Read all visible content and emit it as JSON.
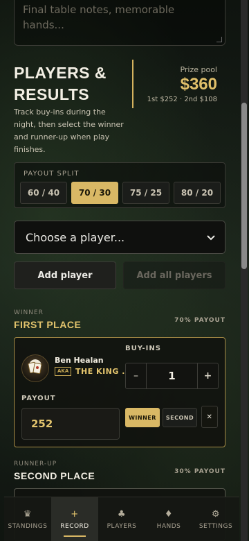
{
  "notes": {
    "placeholder": "Final table notes, memorable hands..."
  },
  "section": {
    "title": "PLAYERS & RESULTS",
    "description": "Track buy-ins during the night, then select the winner and runner-up when play finishes."
  },
  "prize_pool": {
    "label": "Prize pool",
    "amount": "$360",
    "split": "1st $252 · 2nd $108"
  },
  "payout_split": {
    "label": "PAYOUT SPLIT",
    "options": [
      "60 / 40",
      "70 / 30",
      "75 / 25",
      "80 / 20"
    ],
    "selected": "70 / 30"
  },
  "player_select": {
    "value": "Choose a player..."
  },
  "actions": {
    "add_player": "Add player",
    "add_all_players": "Add all players"
  },
  "first_place": {
    "kicker": "WINNER",
    "title": "FIRST PLACE",
    "payout_pct": "70% PAYOUT",
    "player": {
      "name": "Ben Healan",
      "aka_label": "AKA",
      "aka": "THE KING ..."
    },
    "buyins_label": "BUY-INS",
    "buyins": "1",
    "minus": "–",
    "plus": "+",
    "payout_label": "PAYOUT",
    "payout": "252",
    "winner_label": "WINNER",
    "second_label": "SECOND",
    "remove": "✕"
  },
  "second_place": {
    "kicker": "RUNNER-UP",
    "title": "SECOND PLACE",
    "payout_pct": "30% PAYOUT"
  },
  "tabs": [
    {
      "label": "STANDINGS",
      "icon": "crown-icon",
      "active": false
    },
    {
      "label": "RECORD",
      "icon": "plus-icon",
      "active": true
    },
    {
      "label": "PLAYERS",
      "icon": "club-icon",
      "active": false
    },
    {
      "label": "HANDS",
      "icon": "diamond-icon",
      "active": false
    },
    {
      "label": "SETTINGS",
      "icon": "gear-icon",
      "active": false
    }
  ],
  "colors": {
    "accent": "#d9b865",
    "gold_text": "#e3c46d",
    "background": "#101510"
  }
}
